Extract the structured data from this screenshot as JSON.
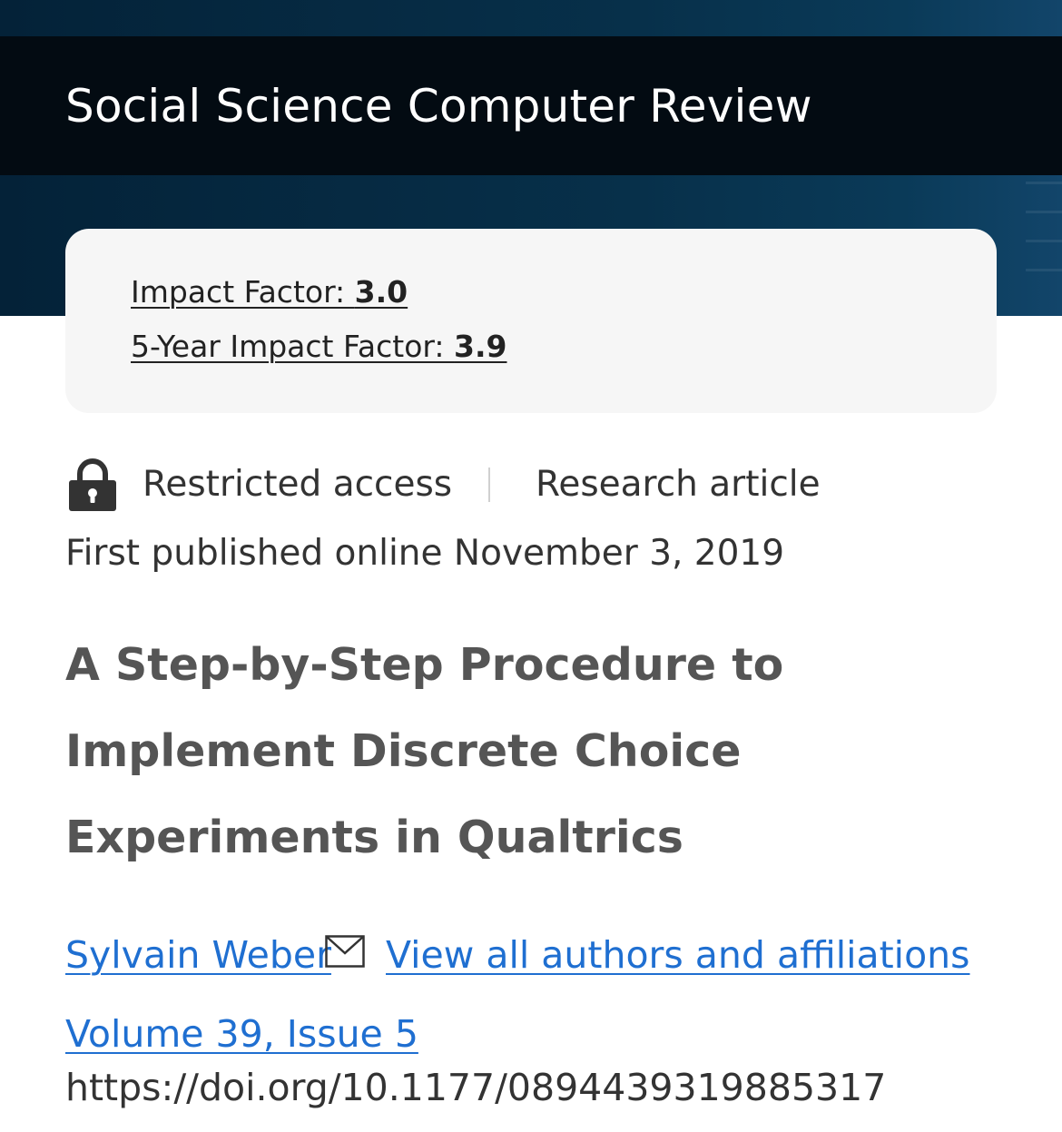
{
  "journal": {
    "title": "Social Science Computer Review"
  },
  "metrics": {
    "impact_factor_label": "Impact Factor: ",
    "impact_factor_value": "3.0",
    "five_year_label": "5-Year Impact Factor: ",
    "five_year_value": "3.9"
  },
  "article": {
    "access": "Restricted access",
    "type": "Research article",
    "published": "First published online November 3, 2019",
    "title": "A Step-by-Step Procedure to Implement Discrete Choice Experiments in Qualtrics",
    "author": "Sylvain Weber",
    "all_authors_link": "View all authors and affiliations",
    "issue": "Volume 39, Issue 5",
    "doi": "https://doi.org/10.1177/0894439319885317"
  },
  "icons": {
    "access": "lock-icon",
    "contact": "mail-icon"
  },
  "colors": {
    "header_bg": "#030b12",
    "hero_bg": "#07304a",
    "link": "#1f6fd1",
    "title_text": "#555555"
  }
}
